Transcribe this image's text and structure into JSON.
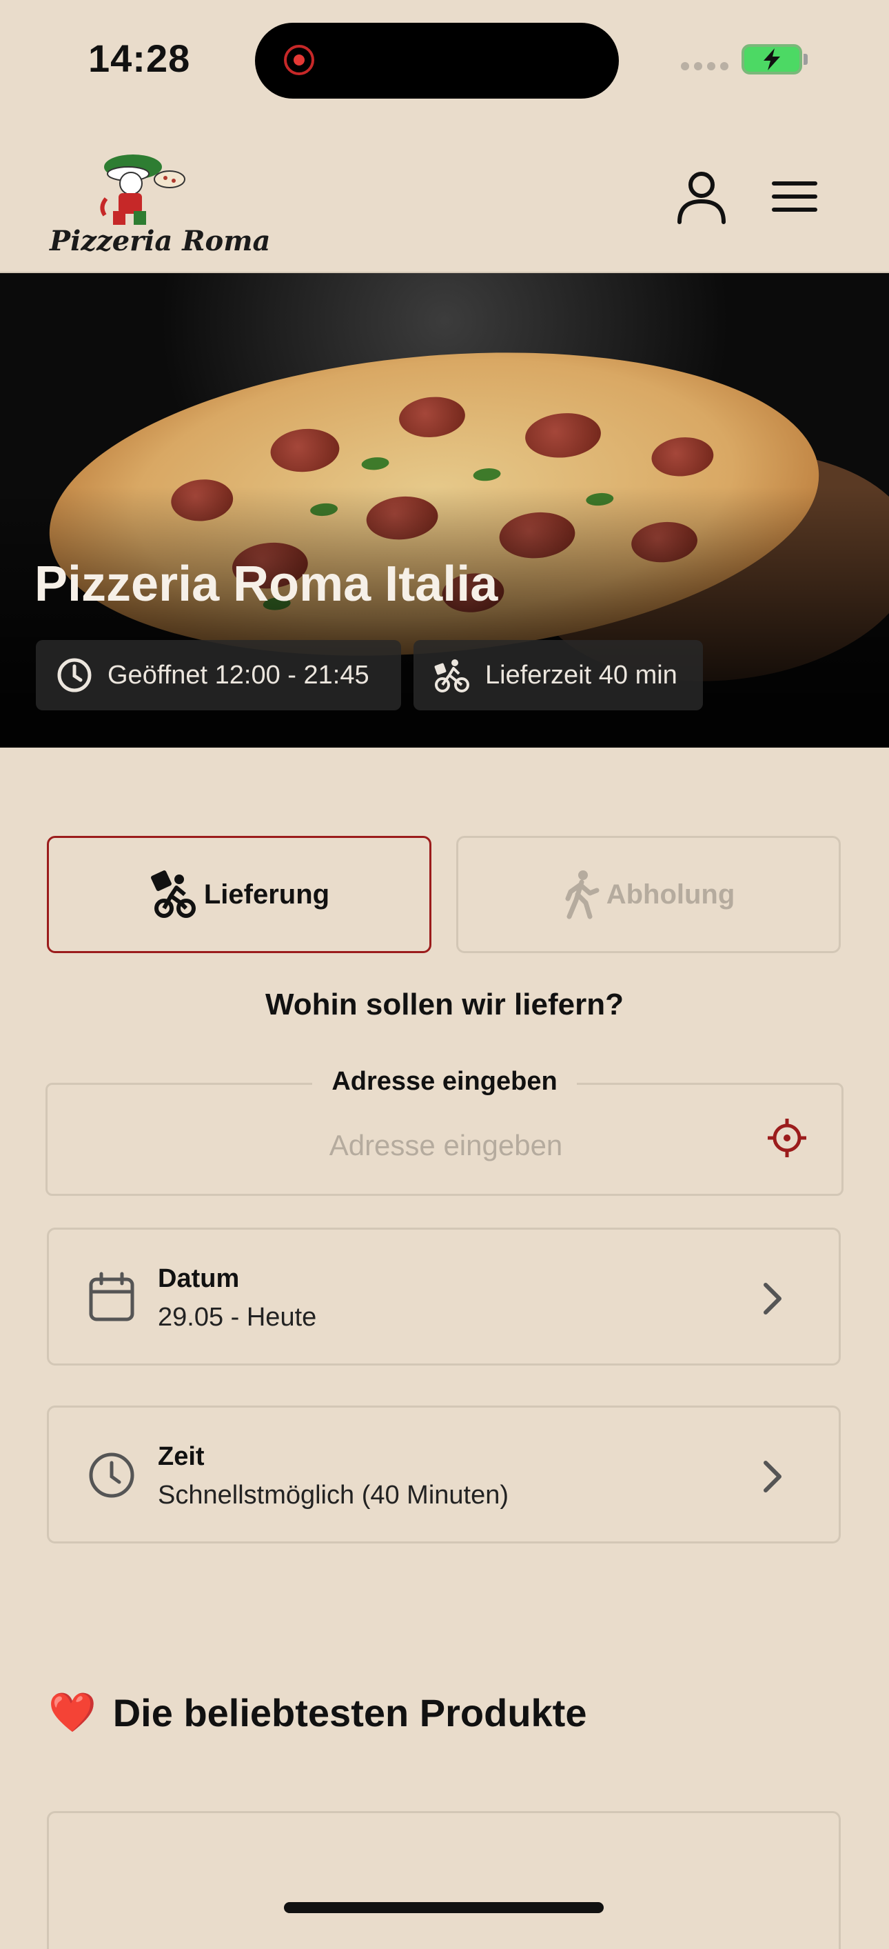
{
  "status_bar": {
    "time": "14:28"
  },
  "brand": {
    "logo_text": "Pizzeria Roma"
  },
  "hero": {
    "title": "Pizzeria Roma Italia",
    "opening_hours": "Geöffnet 12:00 - 21:45",
    "delivery_time": "Lieferzeit 40 min"
  },
  "order_mode": {
    "delivery_label": "Lieferung",
    "pickup_label": "Abholung",
    "selected": "delivery"
  },
  "delivery": {
    "question": "Wohin sollen wir liefern?",
    "address_label": "Adresse eingeben",
    "address_placeholder": "Adresse eingeben",
    "address_value": ""
  },
  "date_card": {
    "title": "Datum",
    "value": "29.05 - Heute"
  },
  "time_card": {
    "title": "Zeit",
    "value": "Schnellstmöglich (40 Minuten)"
  },
  "popular": {
    "emoji": "❤️",
    "title": "Die beliebtesten Produkte"
  },
  "colors": {
    "background": "#e9dccb",
    "accent": "#9b1c1c",
    "border": "#d3c7b6",
    "muted": "#b5ab9e"
  },
  "icons": [
    "user-icon",
    "menu-icon",
    "clock-icon",
    "bike-icon",
    "walk-icon",
    "crosshair-icon",
    "calendar-icon",
    "chevron-right-icon",
    "heart-icon"
  ]
}
